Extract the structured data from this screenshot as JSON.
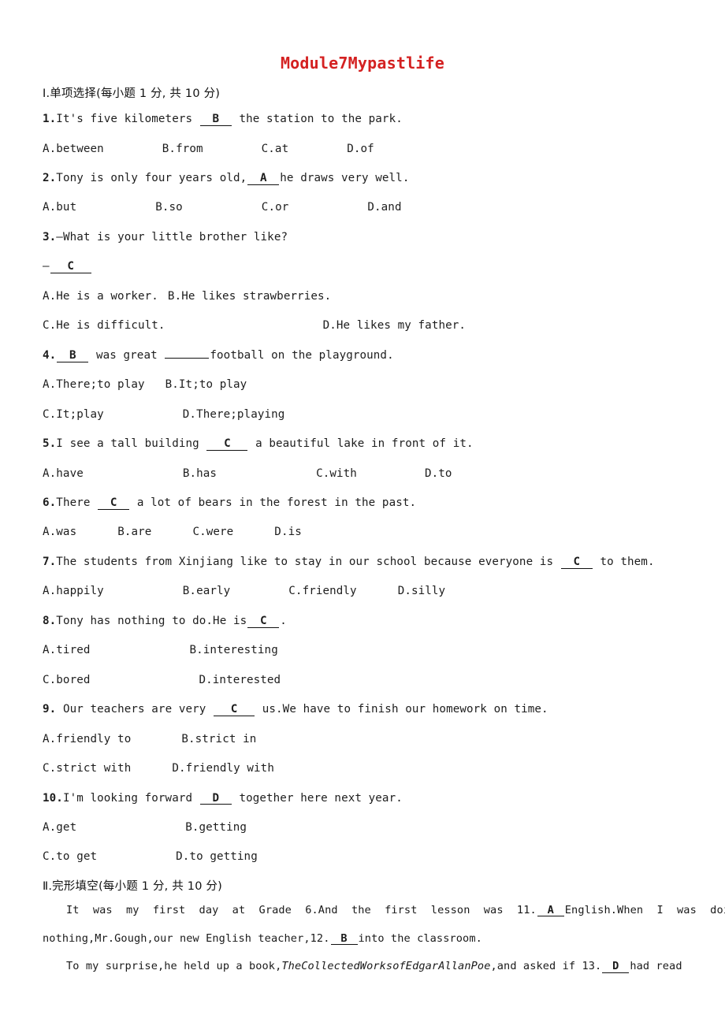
{
  "document": {
    "title": "Module7Mypastlife",
    "title_color": "#d42121"
  },
  "section1": {
    "heading": "Ⅰ.单项选择(每小题 1 分, 共 10 分)",
    "questions": [
      {
        "num": "1.",
        "stem_before": "It's five kilometers",
        "answer": "B",
        "stem_after": "the station to the park.",
        "options_lines": [
          [
            "A.between",
            "B.from",
            "C.at",
            "D.of"
          ]
        ]
      },
      {
        "num": "2.",
        "stem_before": "Tony is only four years old,",
        "answer": "A",
        "stem_after": "he draws very well.",
        "options_lines": [
          [
            "A.but",
            "B.so",
            "C.or",
            "D.and"
          ]
        ]
      },
      {
        "num": "3.",
        "stem_before": "—What is your little brother like?",
        "answer": "C",
        "answer_prefix": "—",
        "options_lines": [
          [
            "A.He is a worker.",
            "B.He likes strawberries."
          ],
          [
            "C.He is difficult.",
            "D.He likes my father."
          ]
        ]
      },
      {
        "num": "4.",
        "answer": "B",
        "stem_mid": "was great",
        "blank2": "",
        "stem_after": "football on the playground.",
        "options_lines": [
          [
            "A.There;to play",
            "B.It;to play"
          ],
          [
            "C.It;play",
            "D.There;playing"
          ]
        ]
      },
      {
        "num": "5.",
        "stem_before": "I see a tall building",
        "answer": "C",
        "stem_after": "a beautiful lake in front of it.",
        "options_lines": [
          [
            "A.have",
            "B.has",
            "C.with",
            "D.to"
          ]
        ]
      },
      {
        "num": "6.",
        "stem_before": "There",
        "answer": "C",
        "stem_after": "a lot of bears in the forest in the past.",
        "options_lines": [
          [
            "A.was",
            "B.are",
            "C.were",
            "D.is"
          ]
        ]
      },
      {
        "num": "7.",
        "stem_before": "The students from Xinjiang like to stay in our school because everyone is",
        "answer": "C",
        "stem_after": "to them.",
        "options_lines": [
          [
            "A.happily",
            "B.early",
            "C.friendly",
            "D.silly"
          ]
        ]
      },
      {
        "num": "8.",
        "stem_before": "Tony has nothing to do.He is",
        "answer": "C",
        "stem_after": ".",
        "options_lines": [
          [
            "A.tired",
            "B.interesting"
          ],
          [
            "C.bored",
            "D.interested"
          ]
        ]
      },
      {
        "num": "9.",
        "stem_before": "Our teachers are very",
        "answer": "C",
        "stem_after": "us.We have to finish our homework on time.",
        "options_lines": [
          [
            "A.friendly to",
            "B.strict in"
          ],
          [
            "C.strict with",
            "D.friendly with"
          ]
        ]
      },
      {
        "num": "10.",
        "stem_before": "I'm looking forward",
        "answer": "D",
        "stem_after": "together here next year.",
        "options_lines": [
          [
            "A.get",
            "B.getting"
          ],
          [
            "C.to get",
            "D.to getting"
          ]
        ]
      }
    ]
  },
  "section2": {
    "heading": "Ⅱ.完形填空(每小题 1 分, 共 10 分)",
    "paragraph1": {
      "part1": "It was my first day at Grade 6.And the first lesson was 11.",
      "answer1": "A",
      "part2": "English.When I was doing",
      "part3": "nothing,Mr.Gough,our new English teacher,12.",
      "answer2": "B",
      "part4": "into the classroom."
    },
    "paragraph2": {
      "part1": "To my surprise,he held up a book,",
      "book_title": "TheCollectedWorksofEdgarAllanPoe",
      "part2": ",and asked if 13.",
      "answer1": "D",
      "part3": "had read"
    }
  }
}
